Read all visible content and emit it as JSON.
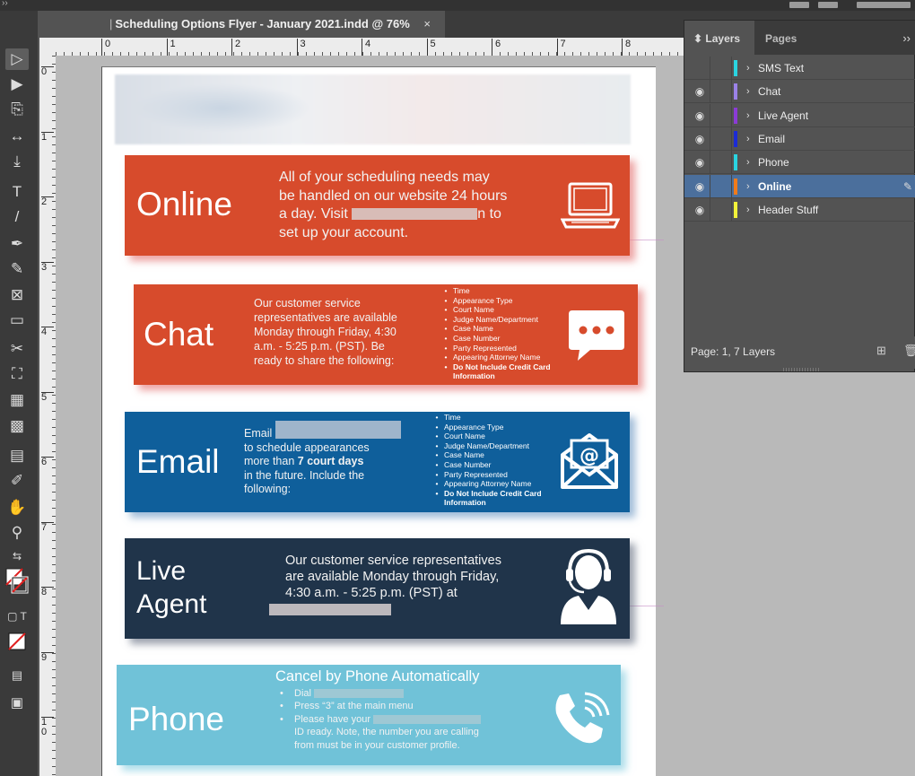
{
  "document": {
    "tab_title": "Scheduling Options Flyer - January 2021.indd @ 76%",
    "close_glyph": "×"
  },
  "ruler": {
    "horizontal": [
      "0",
      "1",
      "2",
      "3",
      "4",
      "5",
      "6",
      "7",
      "8"
    ],
    "vertical": [
      "0",
      "1",
      "2",
      "3",
      "4",
      "5",
      "6",
      "7",
      "8",
      "9",
      "1\n0"
    ]
  },
  "toolbar": {
    "tools": [
      {
        "name": "selection-tool",
        "glyph": "▷",
        "active": true
      },
      {
        "name": "direct-selection-tool",
        "glyph": "▶"
      },
      {
        "name": "page-tool",
        "glyph": "⎘"
      },
      {
        "name": "gap-tool",
        "glyph": "↔"
      },
      {
        "name": "content-collector-tool",
        "glyph": "⤓"
      },
      {
        "name": "type-tool",
        "glyph": "T"
      },
      {
        "name": "line-tool",
        "glyph": "/"
      },
      {
        "name": "pen-tool",
        "glyph": "✒"
      },
      {
        "name": "pencil-tool",
        "glyph": "✎"
      },
      {
        "name": "rectangle-frame-tool",
        "glyph": "⊠"
      },
      {
        "name": "rectangle-tool",
        "glyph": "▭"
      },
      {
        "name": "scissors-tool",
        "glyph": "✂"
      },
      {
        "name": "free-transform-tool",
        "glyph": "⛶"
      },
      {
        "name": "gradient-swatch-tool",
        "glyph": "▦"
      },
      {
        "name": "gradient-feather-tool",
        "glyph": "▩"
      },
      {
        "name": "note-tool",
        "glyph": "▤"
      },
      {
        "name": "eyedropper-tool",
        "glyph": "✐"
      },
      {
        "name": "hand-tool",
        "glyph": "✋"
      },
      {
        "name": "zoom-tool",
        "glyph": "⚲"
      }
    ]
  },
  "flyer": {
    "online": {
      "title": "Online",
      "line1": "All of your scheduling needs may",
      "line2": "be handled on our website 24 hours",
      "line3_pre": "a day. Visit",
      "line3_post": "n to",
      "line4": "set up your account.",
      "icon": "laptop-icon"
    },
    "chat": {
      "title": "Chat",
      "body_lines": [
        "Our customer service",
        "representatives are available",
        "Monday through Friday, 4:30",
        "a.m. - 5:25 p.m. (PST). Be",
        "ready to share the following:"
      ],
      "list": [
        "Time",
        "Appearance Type",
        "Court Name",
        "Judge Name/Department",
        "Case Name",
        "Case Number",
        "Party Represented",
        "Appearing Attorney Name",
        "Do Not Include Credit Card Information"
      ],
      "icon": "chat-bubble-icon"
    },
    "email": {
      "title": "Email",
      "line1": "Email",
      "line2": "to schedule appearances",
      "line3_pre": "more than ",
      "line3_bold": "7 court days",
      "line4": "in the future. Include the",
      "line5": "following:",
      "list": [
        "Time",
        "Appearance Type",
        "Court Name",
        "Judge Name/Department",
        "Case Name",
        "Case Number",
        "Party Represented",
        "Appearing Attorney Name",
        "Do Not Include Credit Card Information"
      ],
      "icon": "envelope-icon"
    },
    "agent": {
      "title_line1": "Live",
      "title_line2": "Agent",
      "line1": "Our customer service representatives",
      "line2": "are available Monday through Friday,",
      "line3": "4:30 a.m. - 5:25 p.m. (PST) at",
      "icon": "headset-agent-icon"
    },
    "phone": {
      "title": "Phone",
      "heading": "Cancel by Phone Automatically",
      "items": [
        "Dial",
        "Press “3” at the main menu",
        "Please have your",
        "ID ready. Note, the number you are calling",
        "from must be in your customer profile."
      ],
      "icon": "phone-call-icon"
    },
    "colors": {
      "online": "#d74b2c",
      "chat": "#d74b2c",
      "email": "#0f5f9b",
      "agent": "#20344a",
      "phone": "#70c2d8"
    }
  },
  "layers_panel": {
    "tab_layers": "Layers",
    "tab_pages": "Pages",
    "menu_glyph": "››",
    "layers": [
      {
        "name": "SMS Text",
        "color": "#2ad4e0",
        "visible": false,
        "selected": false
      },
      {
        "name": "Chat",
        "color": "#9b82e8",
        "visible": true,
        "selected": false
      },
      {
        "name": "Live Agent",
        "color": "#8b3bd6",
        "visible": true,
        "selected": false
      },
      {
        "name": "Email",
        "color": "#1c2bd6",
        "visible": true,
        "selected": false
      },
      {
        "name": "Phone",
        "color": "#2ad4e0",
        "visible": true,
        "selected": false
      },
      {
        "name": "Online",
        "color": "#f07b1a",
        "visible": true,
        "selected": true
      },
      {
        "name": "Header Stuff",
        "color": "#f2f23a",
        "visible": true,
        "selected": false
      }
    ],
    "status": "Page: 1, 7 Layers"
  }
}
